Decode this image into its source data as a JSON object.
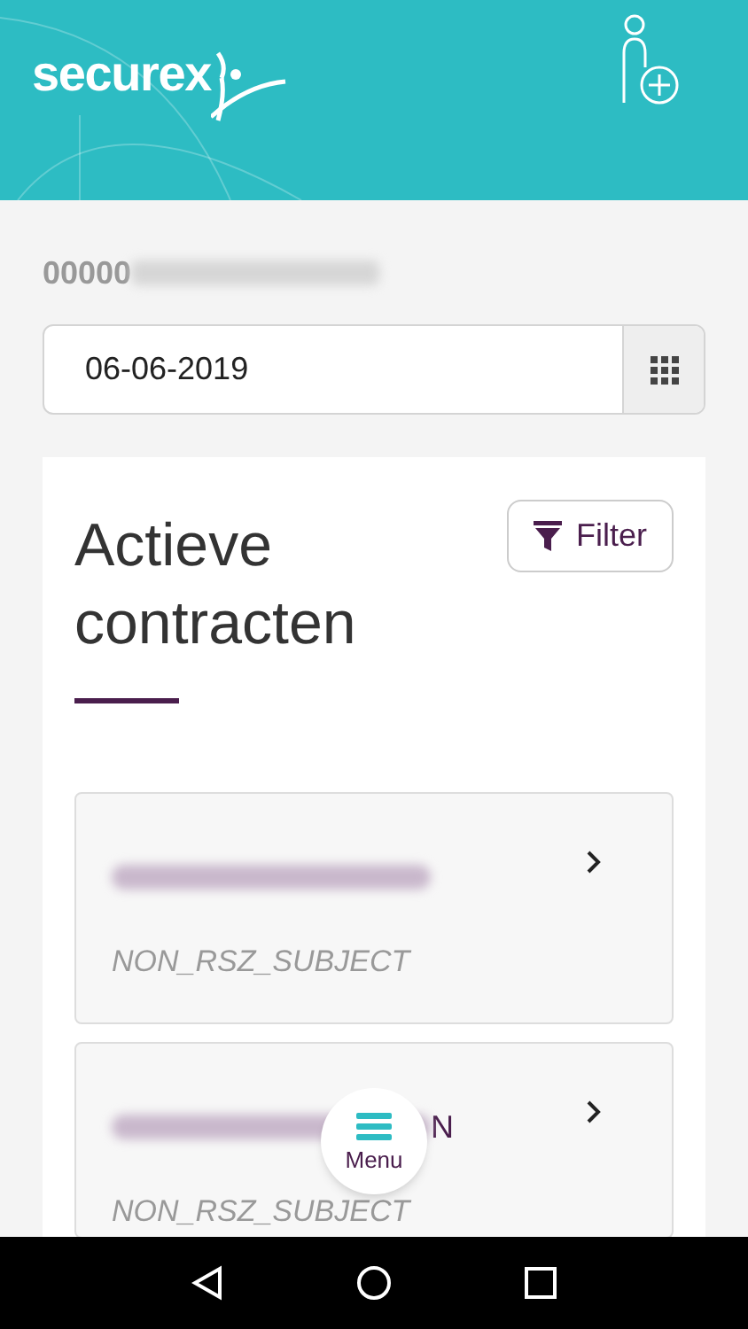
{
  "header": {
    "logo": "securex"
  },
  "account": {
    "number_visible": "00000",
    "redacted": true
  },
  "date_field": {
    "value": "06-06-2019"
  },
  "panel": {
    "title": "Actieve contracten",
    "filter_button": "Filter"
  },
  "contracts": [
    {
      "redacted": true,
      "subject": "NON_RSZ_SUBJECT"
    },
    {
      "redacted": true,
      "name_tail": "N",
      "subject": "NON_RSZ_SUBJECT"
    }
  ],
  "menu_button": {
    "label": "Menu"
  }
}
